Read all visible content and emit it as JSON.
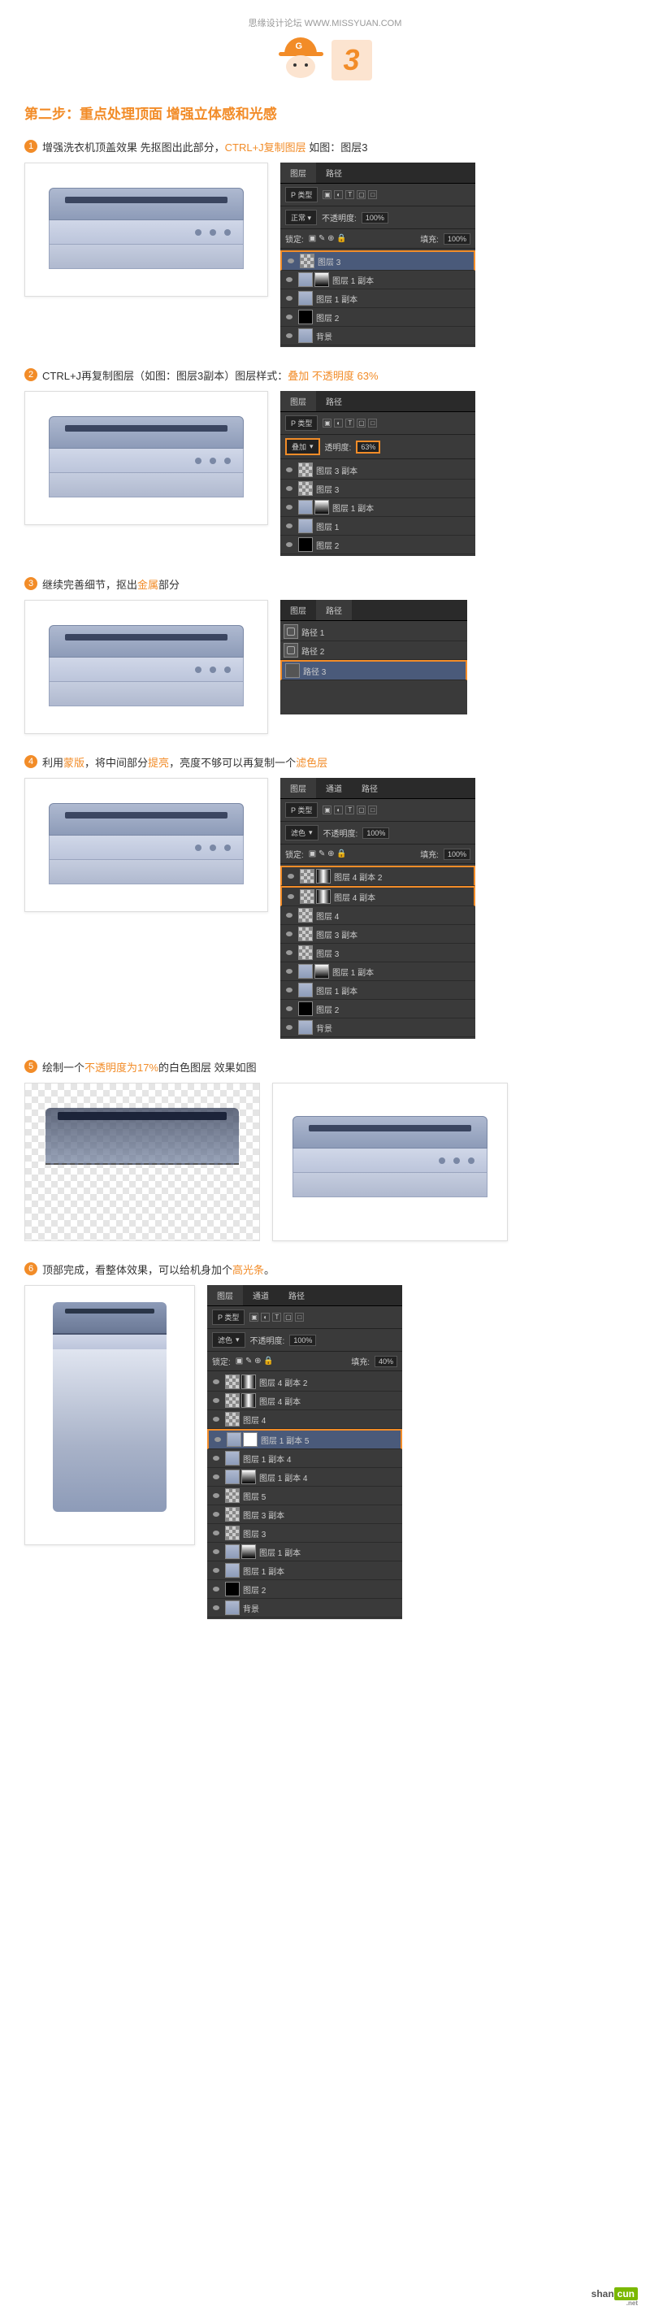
{
  "header": "思缘设计论坛   WWW.MISSYUAN.COM",
  "avatar_badge": "G",
  "step_number": "3",
  "section_title": "第二步：重点处理顶面 增强立体感和光感",
  "steps": [
    {
      "num": "1",
      "text_pre": "增强洗衣机顶盖效果 先抠图出此部分，",
      "hl": "CTRL+J复制图层",
      "text_post": " 如图：图层3"
    },
    {
      "num": "2",
      "text_pre": "CTRL+J再复制图层（如图：图层3副本）图层样式：",
      "hl": "叠加 不透明度 63%",
      "text_post": ""
    },
    {
      "num": "3",
      "text_pre": "继续完善细节，抠出",
      "hl": "金属",
      "text_post": "部分"
    },
    {
      "num": "4",
      "text_pre": "利用",
      "hl": "蒙版",
      "text_mid": "，将中间部分",
      "hl2": "提亮",
      "text_post": "，亮度不够可以再复制一个",
      "hl3": "滤色层"
    },
    {
      "num": "5",
      "text_pre": "绘制一个",
      "hl": "不透明度为17%",
      "text_post": "的白色图层 效果如图"
    },
    {
      "num": "6",
      "text_pre": "顶部完成，看整体效果，可以给机身加个",
      "hl": "高光条",
      "text_post": "。"
    }
  ],
  "panel_tabs": {
    "layers": "图层",
    "channels": "通道",
    "paths": "路径"
  },
  "panel1": {
    "kind": "P 类型",
    "opacity_label": "不透明度:",
    "opacity": "100%",
    "fill_label": "填充:",
    "fill": "100%",
    "lock": "锁定:",
    "layers": [
      {
        "name": "图层 3",
        "sel": true,
        "thumb": "checker",
        "hl": true
      },
      {
        "name": "图层 1 副本",
        "thumbs": [
          "img",
          "grad"
        ]
      },
      {
        "name": "图层 1 副本",
        "thumb": "img"
      },
      {
        "name": "图层 2",
        "thumb": "black"
      },
      {
        "name": "背景",
        "thumb": "img"
      }
    ]
  },
  "panel2": {
    "kind": "P 类型",
    "blend": "叠加",
    "blend_hl": true,
    "opacity_label": "透明度:",
    "opacity": "63%",
    "opacity_hl": true,
    "layers": [
      {
        "name": "图层 3 副本",
        "thumb": "checker"
      },
      {
        "name": "图层 3",
        "thumb": "checker"
      },
      {
        "name": "图层 1 副本",
        "thumbs": [
          "img",
          "grad"
        ]
      },
      {
        "name": "图层 1",
        "thumb": "img"
      },
      {
        "name": "图层 2",
        "thumb": "black"
      }
    ]
  },
  "panel3": {
    "paths": [
      {
        "name": "路径 1"
      },
      {
        "name": "路径 2"
      },
      {
        "name": "路径 3",
        "sel": true,
        "hl": true
      }
    ]
  },
  "panel4": {
    "kind": "P 类型",
    "opacity_label": "不透明度:",
    "opacity": "100%",
    "fill_label": "填充:",
    "fill": "100%",
    "lock": "锁定:",
    "blend": "滤色",
    "layers": [
      {
        "name": "图层 4 副本 2",
        "thumbs": [
          "checker",
          "mask"
        ],
        "hl": true
      },
      {
        "name": "图层 4 副本",
        "thumbs": [
          "checker",
          "mask"
        ],
        "hl": true
      },
      {
        "name": "图层 4",
        "thumb": "checker"
      },
      {
        "name": "图层 3 副本",
        "thumb": "checker"
      },
      {
        "name": "图层 3",
        "thumb": "checker"
      },
      {
        "name": "图层 1 副本",
        "thumbs": [
          "img",
          "grad"
        ]
      },
      {
        "name": "图层 1 副本",
        "thumb": "img"
      },
      {
        "name": "图层 2",
        "thumb": "black"
      },
      {
        "name": "背景",
        "thumb": "img"
      }
    ]
  },
  "panel6": {
    "kind": "P 类型",
    "opacity_label": "不透明度:",
    "opacity": "100%",
    "fill_label": "填充:",
    "fill": "40%",
    "lock": "锁定:",
    "blend": "滤色",
    "layers": [
      {
        "name": "图层 4 副本 2",
        "thumbs": [
          "checker",
          "mask"
        ]
      },
      {
        "name": "图层 4 副本",
        "thumbs": [
          "checker",
          "mask"
        ]
      },
      {
        "name": "图层 4",
        "thumb": "checker"
      },
      {
        "name": "图层 1 副本 5",
        "thumbs": [
          "img",
          "white"
        ],
        "sel": true,
        "hl": true
      },
      {
        "name": "图层 1 副本 4",
        "thumb": "img"
      },
      {
        "name": "图层 1 副本 4",
        "thumbs": [
          "img",
          "grad"
        ]
      },
      {
        "name": "图层 5",
        "thumb": "checker"
      },
      {
        "name": "图层 3 副本",
        "thumb": "checker"
      },
      {
        "name": "图层 3",
        "thumb": "checker"
      },
      {
        "name": "图层 1 副本",
        "thumbs": [
          "img",
          "grad"
        ]
      },
      {
        "name": "图层 1 副本",
        "thumb": "img"
      },
      {
        "name": "图层 2",
        "thumb": "black"
      },
      {
        "name": "背景",
        "thumb": "img"
      }
    ]
  },
  "watermark": {
    "s1": "shan",
    "s2": "cun",
    "ext": ".net"
  }
}
